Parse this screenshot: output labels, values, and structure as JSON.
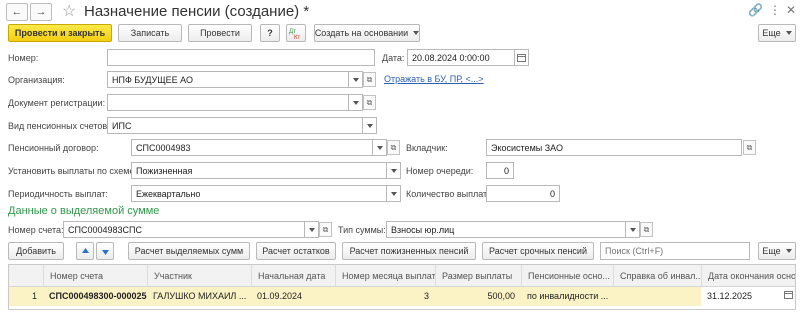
{
  "window": {
    "title": "Назначение пенсии (создание) *"
  },
  "toolbar": {
    "post_close": "Провести и закрыть",
    "save": "Записать",
    "post": "Провести",
    "help": "?",
    "create_based": "Создать на основании",
    "more": "Еще"
  },
  "form": {
    "number_label": "Номер:",
    "number_value": "",
    "date_label": "Дата:",
    "date_value": "20.08.2024  0:00:00",
    "org_label": "Организация:",
    "org_value": "НПФ БУДУЩЕЕ АО",
    "reflect_link": "Отражать в БУ, ПР, <...>",
    "regdoc_label": "Документ регистрации:",
    "regdoc_value": "",
    "acctype_label": "Вид пенсионных счетов:",
    "acctype_value": "ИПС",
    "contract_label": "Пенсионный договор:",
    "contract_value": "СПС0004983",
    "depositor_label": "Вкладчик:",
    "depositor_value": "Экосистемы ЗАО",
    "scheme_label": "Установить выплаты по схеме:",
    "scheme_value": "Пожизненная",
    "queue_label": "Номер очереди:",
    "queue_value": "0",
    "period_label": "Периодичность выплат:",
    "period_value": "Ежеквартально",
    "count_label": "Количество выплат:",
    "count_value": "0"
  },
  "allocation": {
    "section_title": "Данные о выделяемой сумме",
    "account_label": "Номер счета:",
    "account_value": "СПС0004983СПС",
    "sumtype_label": "Тип суммы:",
    "sumtype_value": "Взносы юр.лиц"
  },
  "table_toolbar": {
    "add": "Добавить",
    "calc_allocated": "Расчет выделяемых сумм",
    "calc_remainder": "Расчет остатков",
    "calc_lifetime": "Расчет пожизненных пенсий",
    "calc_term": "Расчет срочных пенсий",
    "search_placeholder": "Поиск (Ctrl+F)",
    "more": "Еще"
  },
  "table": {
    "columns": [
      "Номер счета",
      "Участник",
      "Начальная дата",
      "Номер месяца выплат",
      "Размер выплаты",
      "Пенсионные осно...",
      "Справка об инвал...",
      "Дата окончания осно..."
    ],
    "rows": [
      {
        "n": "1",
        "account": "СПС000498300-000025",
        "participant": "ГАЛУШКО МИХАИЛ ...",
        "start_date": "01.09.2024",
        "month_no": "3",
        "amount": "500,00",
        "basis": "по инвалидности ...",
        "certificate": "",
        "end_date": "31.12.2025"
      }
    ]
  },
  "colors": {
    "primary_button": "#f4cf0f",
    "section_title": "#2f9a4a",
    "link": "#2b5fb3",
    "selected_row": "#fbf3c5"
  }
}
